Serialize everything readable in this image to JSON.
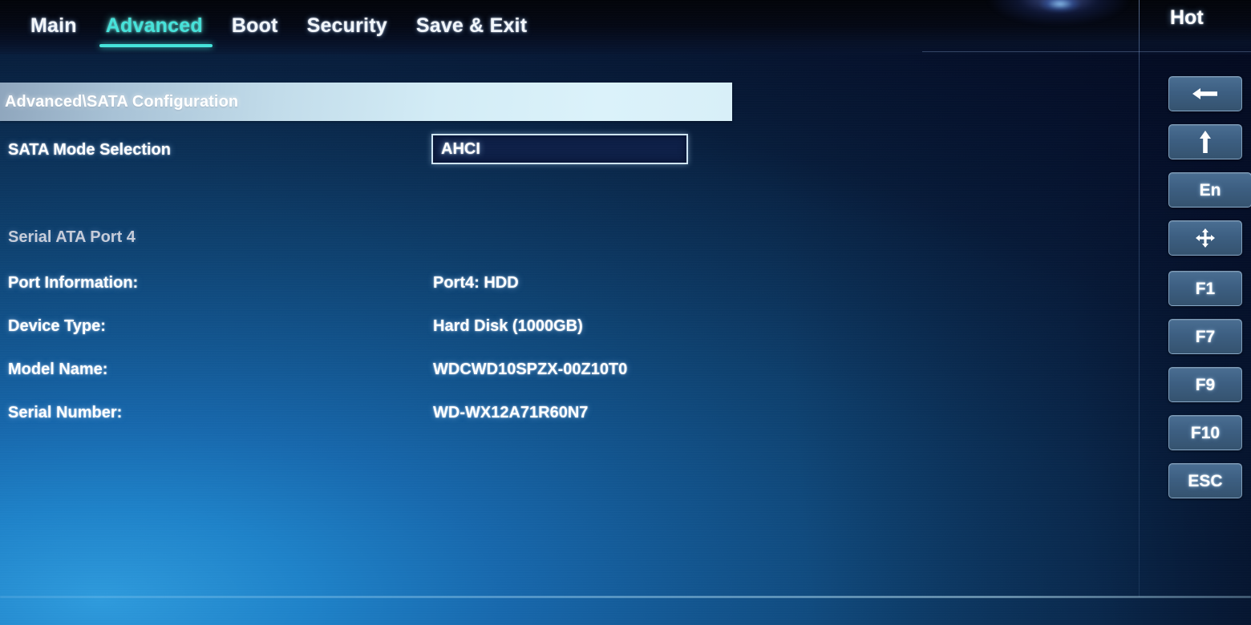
{
  "menu": {
    "tabs": [
      {
        "label": "Main",
        "active": false
      },
      {
        "label": "Advanced",
        "active": true
      },
      {
        "label": "Boot",
        "active": false
      },
      {
        "label": "Security",
        "active": false
      },
      {
        "label": "Save & Exit",
        "active": false
      }
    ],
    "active_tab": "Advanced",
    "accent_color": "#46e3da"
  },
  "breadcrumb": {
    "text": "Advanced\\SATA Configuration"
  },
  "settings": {
    "sata_mode": {
      "label": "SATA Mode Selection",
      "value": "AHCI",
      "selected": true
    }
  },
  "port_section": {
    "heading": "Serial ATA Port 4",
    "fields": [
      {
        "label": "Port Information:",
        "value": "Port4: HDD"
      },
      {
        "label": "Device Type:",
        "value": "Hard Disk (1000GB)"
      },
      {
        "label": "Model Name:",
        "value": "WDCWD10SPZX-00Z10T0"
      },
      {
        "label": "Serial Number:",
        "value": "WD-WX12A71R60N7"
      }
    ]
  },
  "hotkeys": {
    "title": "Hot",
    "buttons": [
      {
        "glyph": "←",
        "icon": "arrow-left-icon",
        "kind": "arrow"
      },
      {
        "glyph": "↑",
        "icon": "arrow-up-icon",
        "kind": "arrow"
      },
      {
        "glyph": "En",
        "icon": "enter-key-icon",
        "kind": "text"
      },
      {
        "glyph": "✚",
        "icon": "move-arrows-icon",
        "kind": "arrow"
      },
      {
        "glyph": "F1",
        "icon": "f1-key-icon",
        "kind": "text"
      },
      {
        "glyph": "F7",
        "icon": "f7-key-icon",
        "kind": "text"
      },
      {
        "glyph": "F9",
        "icon": "f9-key-icon",
        "kind": "text"
      },
      {
        "glyph": "F10",
        "icon": "f10-key-icon",
        "kind": "text"
      },
      {
        "glyph": "ESC",
        "icon": "esc-key-icon",
        "kind": "text"
      }
    ]
  },
  "theme": {
    "bg_dark": "#061732",
    "bg_mid": "#12558f",
    "bg_light": "#2e9bdd",
    "text": "#ffffff",
    "text_dim": "#c6ccd9",
    "select_fill": "#0d1f47",
    "select_border": "#cfe6f5",
    "breadcrumb_light": "#d8eff8",
    "hotkey_btn": "#3d5f82"
  }
}
